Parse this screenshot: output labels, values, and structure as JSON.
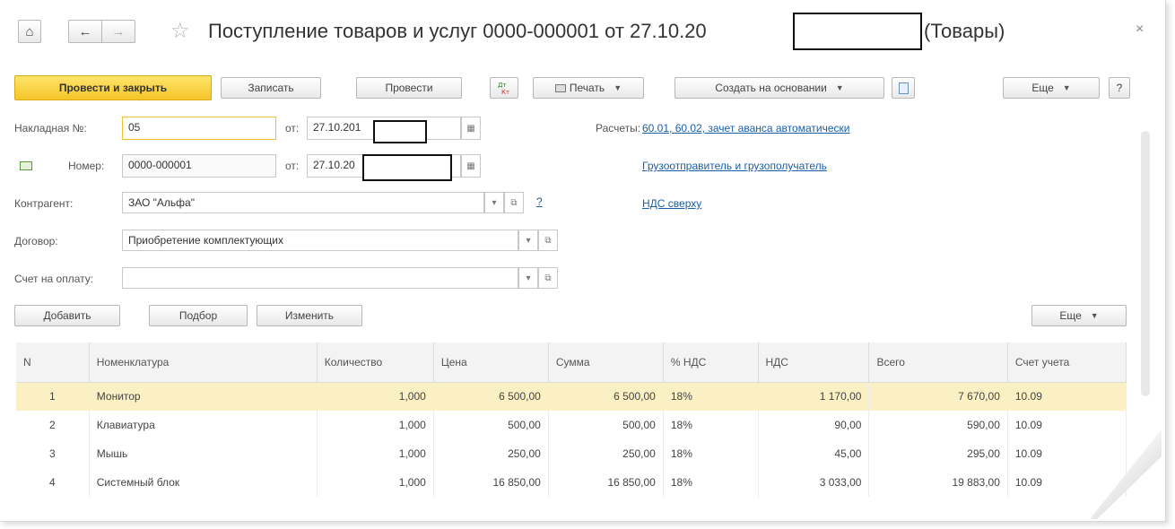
{
  "window": {
    "title": "Поступление товаров и услуг 0000-000001 от 27.10.20",
    "title_suffix": "(Товары)",
    "close_glyph": "×"
  },
  "nav": {
    "home_glyph": "⌂",
    "back_glyph": "←",
    "forward_glyph": "→",
    "star_glyph": "☆"
  },
  "toolbar": {
    "post_close": "Провести и закрыть",
    "save": "Записать",
    "post": "Провести",
    "print": "Печать",
    "create_based": "Создать на основании",
    "more": "Еще",
    "help": "?"
  },
  "form": {
    "invoice_label": "Накладная №:",
    "invoice_value": "05",
    "from_label": "от:",
    "invoice_date": "27.10.201",
    "number_label": "Номер:",
    "number_value": "0000-000001",
    "number_date": "27.10.20",
    "counterparty_label": "Контрагент:",
    "counterparty_value": "ЗАО \"Альфа\"",
    "contract_label": "Договор:",
    "contract_value": "Приобретение комплектующих",
    "payment_label": "Счет на оплату:",
    "payment_value": "",
    "question": "?"
  },
  "links": {
    "settlements_label": "Расчеты:",
    "settlements_value": "60.01, 60.02, зачет аванса автоматически",
    "shipper": "Грузоотправитель и грузополучатель",
    "vat": "НДС сверху"
  },
  "table_toolbar": {
    "add": "Добавить",
    "pick": "Подбор",
    "edit": "Изменить",
    "more": "Еще"
  },
  "table": {
    "headers": [
      "N",
      "Номенклатура",
      "Количество",
      "Цена",
      "Сумма",
      "% НДС",
      "НДС",
      "Всего",
      "Счет учета"
    ],
    "rows": [
      [
        "1",
        "Монитор",
        "1,000",
        "6 500,00",
        "6 500,00",
        "18%",
        "1 170,00",
        "7 670,00",
        "10.09"
      ],
      [
        "2",
        "Клавиатура",
        "1,000",
        "500,00",
        "500,00",
        "18%",
        "90,00",
        "590,00",
        "10.09"
      ],
      [
        "3",
        "Мышь",
        "1,000",
        "250,00",
        "250,00",
        "18%",
        "45,00",
        "295,00",
        "10.09"
      ],
      [
        "4",
        "Системный блок",
        "1,000",
        "16 850,00",
        "16 850,00",
        "18%",
        "3 033,00",
        "19 883,00",
        "10.09"
      ]
    ]
  },
  "colors": {
    "primary_button": "#f5c52a",
    "link": "#1a5ea8",
    "selected_row": "#fbf0c4"
  }
}
